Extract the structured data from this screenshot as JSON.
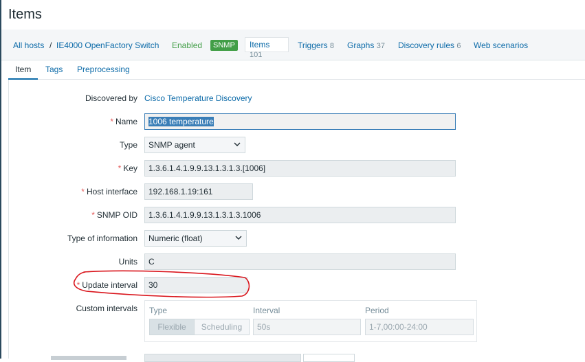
{
  "page": {
    "title": "Items"
  },
  "breadcrumb": {
    "all_hosts": "All hosts",
    "separator": "/",
    "host": "IE4000 OpenFactory Switch",
    "status": "Enabled",
    "badge": "SNMP"
  },
  "host_nav": {
    "tabs": [
      {
        "label": "Items",
        "count": "101"
      },
      {
        "label": "Triggers",
        "count": "8"
      },
      {
        "label": "Graphs",
        "count": "37"
      },
      {
        "label": "Discovery rules",
        "count": "6"
      },
      {
        "label": "Web scenarios",
        "count": ""
      }
    ]
  },
  "form_tabs": [
    "Item",
    "Tags",
    "Preprocessing"
  ],
  "form": {
    "discovered_by": {
      "label": "Discovered by",
      "value": "Cisco Temperature Discovery"
    },
    "name": {
      "label": "Name",
      "value": "1006 temperature"
    },
    "type": {
      "label": "Type",
      "value": "SNMP agent"
    },
    "key": {
      "label": "Key",
      "value": "1.3.6.1.4.1.9.9.13.1.3.1.3.[1006]"
    },
    "host_interface": {
      "label": "Host interface",
      "value": "192.168.1.19:161"
    },
    "snmp_oid": {
      "label": "SNMP OID",
      "value": "1.3.6.1.4.1.9.9.13.1.3.1.3.1006"
    },
    "type_of_information": {
      "label": "Type of information",
      "value": "Numeric (float)"
    },
    "units": {
      "label": "Units",
      "value": "C"
    },
    "update_interval": {
      "label": "Update interval",
      "value": "30"
    },
    "custom_intervals": {
      "label": "Custom intervals",
      "col_type": "Type",
      "col_interval": "Interval",
      "col_period": "Period",
      "type_flexible": "Flexible",
      "type_scheduling": "Scheduling",
      "interval_value": "50s",
      "period_value": "1-7,00:00-24:00"
    }
  },
  "colors": {
    "link": "#0b6aa8",
    "enabled": "#429e47",
    "required": "#e45959",
    "annotation": "#d9141b"
  },
  "icons": [
    "chevron-down-icon"
  ]
}
